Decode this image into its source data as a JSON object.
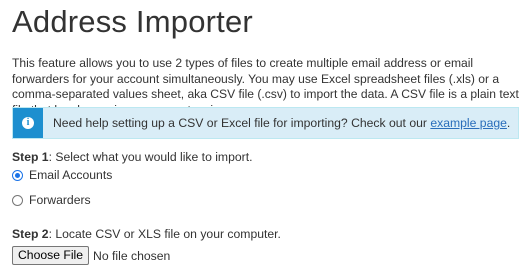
{
  "page": {
    "title": "Address Importer",
    "intro": "This feature allows you to use 2 types of files to create multiple email address or email forwarders for your account simultaneously. You may use Excel spreadsheet files (.xls) or a comma-separated values sheet, aka CSV file (.csv) to import the data. A CSV file is a plain text file that has been given a .csv extension."
  },
  "info": {
    "icon": "info-icon",
    "text": "Need help setting up a CSV or Excel file for importing? Check out our ",
    "link_label": "example page",
    "suffix": "."
  },
  "step1": {
    "label": "Step 1",
    "text": ": Select what you would like to import.",
    "options": [
      {
        "label": "Email Accounts",
        "checked": true
      },
      {
        "label": "Forwarders",
        "checked": false
      }
    ]
  },
  "step2": {
    "label": "Step 2",
    "text": ": Locate CSV or XLS file on your computer.",
    "file_button": "Choose File",
    "file_status": "No file chosen"
  },
  "colors": {
    "info_bg": "#d9edf7",
    "info_icon_bg": "#1d8fcf",
    "link": "#2a6ebb"
  }
}
